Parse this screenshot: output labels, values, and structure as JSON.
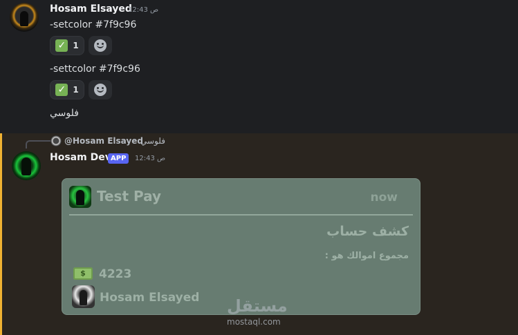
{
  "message1": {
    "author": "Hosam Elsayed",
    "time": "12:43 ص",
    "lines": [
      "-setcolor #7f9c96",
      "-settcolor #7f9c96",
      "فلوسي"
    ],
    "reactions": [
      {
        "emoji": "✓",
        "count": "1"
      },
      {
        "emoji": "✓",
        "count": "1"
      }
    ]
  },
  "message2": {
    "reply": {
      "mention": "@Hosam Elsayed",
      "text": "فلوسي"
    },
    "author": "Hosam Dev",
    "badge": "APP",
    "time": "12:43 ص",
    "embed": {
      "accent_color": "#7f9c96",
      "title": "Test Pay",
      "timestamp": "now",
      "heading": "كشف حساب",
      "subtitle": "مجموع اموالك هو :",
      "money_icon": "banknote-icon",
      "amount": "4223",
      "user": "Hosam Elsayed"
    }
  },
  "watermark": {
    "logo": "مستقل",
    "site": "mostaql.com"
  },
  "colors": {
    "background": "#1e1f22",
    "highlight_bg": "#2a251f",
    "highlight_border": "#f0b232",
    "app_badge": "#5865f2",
    "reaction_check": "#77b255"
  }
}
